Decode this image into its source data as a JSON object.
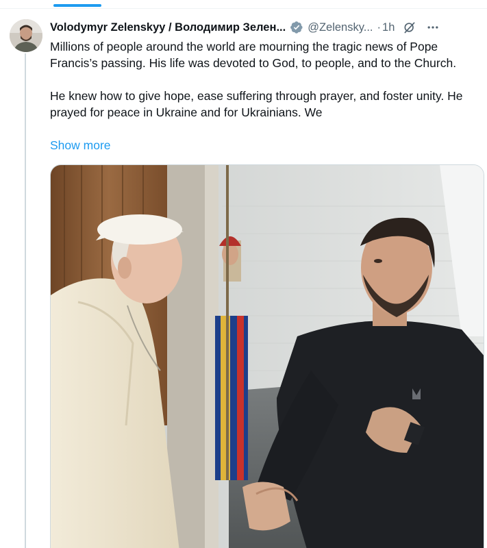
{
  "tweet": {
    "display_name": "Volodymyr Zelenskyy / Володимир Зелен...",
    "handle": "@Zelensky...",
    "separator": "·",
    "time": "1h",
    "paragraph1": "Millions of people around the world are mourning the tragic news of Pope Francis’s passing. His life was devoted to God, to people, and to the Church.",
    "paragraph2": "He knew how to give hope, ease suffering through prayer, and foster unity. He prayed for peace in Ukraine and for Ukrainians. We",
    "show_more": "Show more"
  },
  "icons": {
    "verified": "verified-badge-icon",
    "grok": "grok-icon",
    "more": "more-options-icon"
  },
  "colors": {
    "link": "#1d9bf0",
    "secondary_text": "#536471",
    "primary_text": "#0f1419",
    "verified_gray": "#829aab"
  }
}
